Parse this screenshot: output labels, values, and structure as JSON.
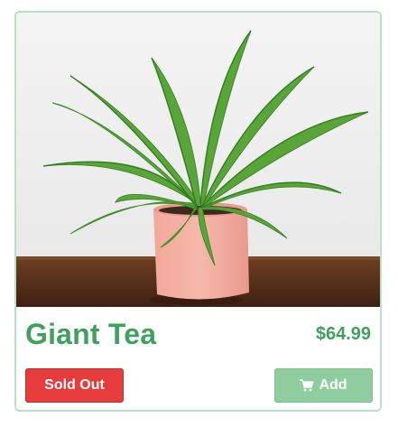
{
  "product": {
    "name": "Giant Tea",
    "price": "$64.99",
    "image_subject": "plant-photo"
  },
  "actions": {
    "sold_out_label": "Sold Out",
    "add_label": "Add",
    "add_icon": "shopping-cart-icon"
  },
  "colors": {
    "accent_green": "#3fa15d",
    "add_button_bg": "#8fcc9e",
    "sold_out_bg": "#e63c3c",
    "card_border": "#b8e2c2"
  }
}
